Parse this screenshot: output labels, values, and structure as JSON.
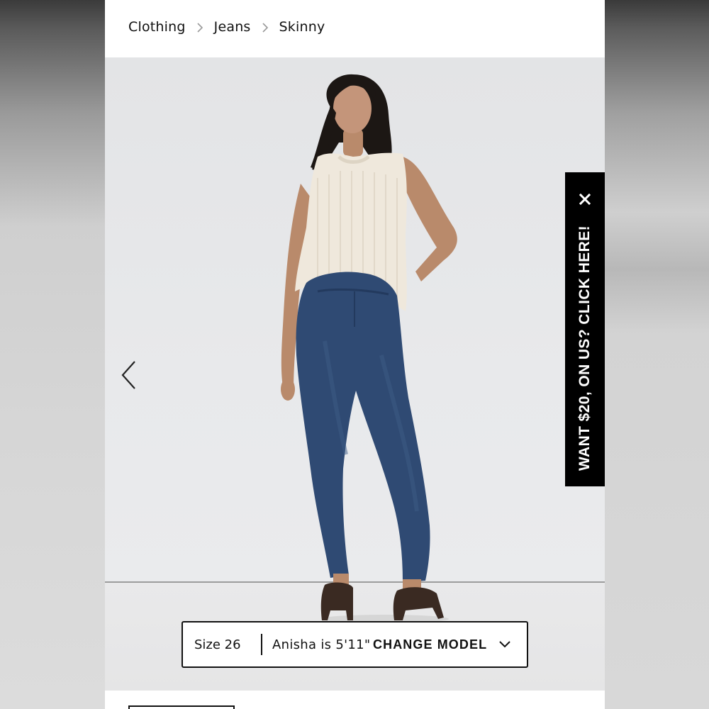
{
  "breadcrumb": {
    "items": [
      {
        "label": "Clothing"
      },
      {
        "label": "Jeans"
      },
      {
        "label": "Skinny"
      }
    ]
  },
  "gallery": {
    "image_alt": "Model wearing cream sleeveless knit sweater and dark wash skinny jeans with brown mules",
    "prev_icon": "chevron-left-icon"
  },
  "promo": {
    "text": "WANT $20, ON US? CLICK HERE!",
    "close_icon": "close-icon"
  },
  "model_bar": {
    "size": "Size 26",
    "model_height": "Anisha is 5'11\"",
    "change_label": "CHANGE MODEL",
    "dropdown_icon": "chevron-down-icon"
  },
  "colors": {
    "background": "#ffffff",
    "text": "#111111",
    "promo_bg": "#000000",
    "promo_text": "#ffffff",
    "denim": "#2f4a73",
    "sweater": "#efe8dc"
  }
}
